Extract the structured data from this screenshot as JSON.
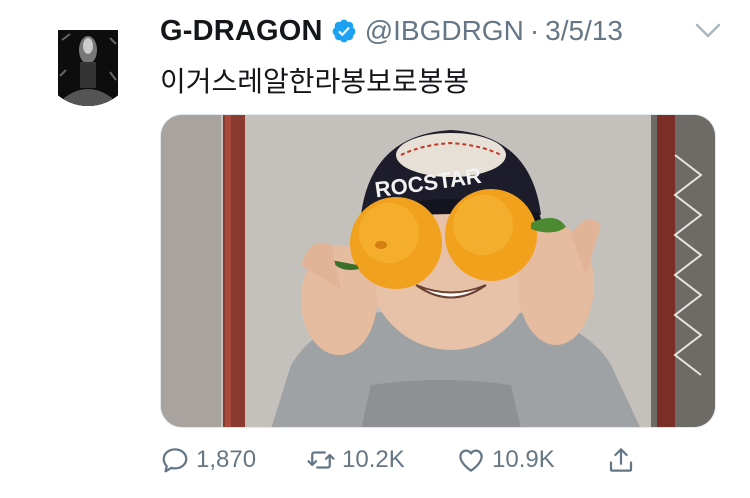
{
  "tweet": {
    "display_name": "G-DRAGON",
    "verified_icon": "verified-badge-icon",
    "handle": "@IBGDRGN",
    "separator": "·",
    "date": "3/5/13",
    "text": "이거스레알한라봉보로봉봉",
    "caret_icon": "chevron-down-icon",
    "media": {
      "cap_text": "ROCSTAR"
    }
  },
  "actions": {
    "reply": {
      "icon": "reply-icon",
      "count": "1,870"
    },
    "retweet": {
      "icon": "retweet-icon",
      "count": "10.2K"
    },
    "like": {
      "icon": "heart-icon",
      "count": "10.9K"
    },
    "share": {
      "icon": "share-icon"
    }
  },
  "colors": {
    "verified_blue": "#1da1f2",
    "muted_text": "#657786",
    "primary_text": "#14171a"
  }
}
